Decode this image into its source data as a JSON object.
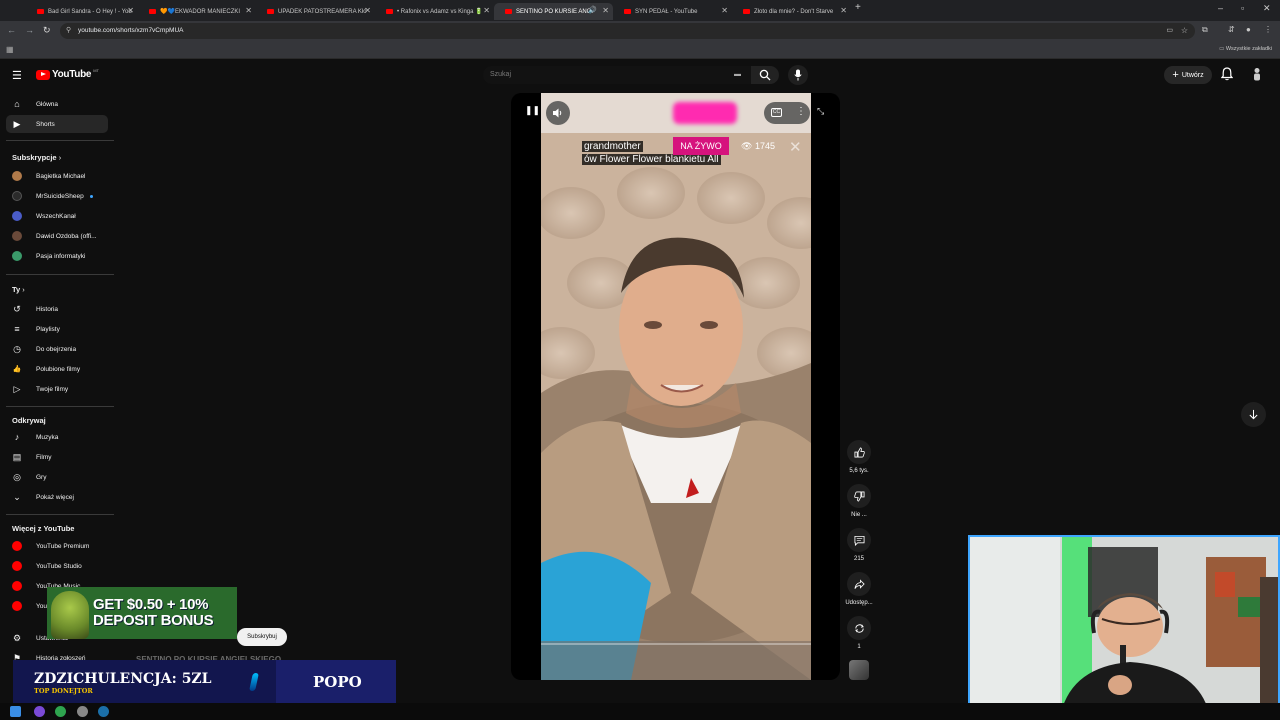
{
  "browser": {
    "tabs": [
      {
        "title": "Bad Girl Sandra - O Hey ! - You",
        "active": false
      },
      {
        "title": "🧡💙EKWADOR MANIECZKI",
        "active": false
      },
      {
        "title": "UPADEK PATOSTREAMERA Kłó",
        "active": false
      },
      {
        "title": "• Rafonix vs Adamz vs Kinga 🔋",
        "active": false
      },
      {
        "title": "SENTINO PO KURSIE ANGI",
        "active": true
      },
      {
        "title": "SYN PEDAŁ - YouTube",
        "active": false
      },
      {
        "title": "Złoto dla mnie? - Don't Starve",
        "active": false
      }
    ],
    "new_tab": "+",
    "url": "youtube.com/shorts/xzm7vCmpMUA",
    "bookmarks_all": "Wszystkie zakładki"
  },
  "header": {
    "logo_text": "YouTube",
    "logo_country": "MT",
    "search_placeholder": "Szukaj",
    "create_label": "Utwórz"
  },
  "sidebar": {
    "main": [
      {
        "label": "Główna",
        "icon": "home-icon",
        "glyph": "⌂"
      },
      {
        "label": "Shorts",
        "icon": "shorts-icon",
        "glyph": "▶"
      }
    ],
    "subs_heading": "Subskrypcje",
    "subs": [
      {
        "label": "Bagietka Michael",
        "color": "#b07a4a",
        "dot": false
      },
      {
        "label": "MrSuicideSheep",
        "color": "#2b2b2b",
        "dot": true
      },
      {
        "label": "WszechKanał",
        "color": "#4a5cc8",
        "dot": false
      },
      {
        "label": "Dawid Ozdoba (offi...",
        "color": "#6a4a3a",
        "dot": false
      },
      {
        "label": "Pasja informatyki",
        "color": "#3a9a6a",
        "dot": false
      }
    ],
    "you_heading": "Ty",
    "you": [
      {
        "label": "Historia",
        "icon": "history-icon",
        "glyph": "↺"
      },
      {
        "label": "Playlisty",
        "icon": "playlists-icon",
        "glyph": "≡"
      },
      {
        "label": "Do obejrzenia",
        "icon": "watch-later-icon",
        "glyph": "◷"
      },
      {
        "label": "Polubione filmy",
        "icon": "liked-icon",
        "glyph": "👍"
      },
      {
        "label": "Twoje filmy",
        "icon": "your-videos-icon",
        "glyph": "▷"
      }
    ],
    "explore_heading": "Odkrywaj",
    "explore": [
      {
        "label": "Muzyka",
        "icon": "music-icon",
        "glyph": "♪"
      },
      {
        "label": "Filmy",
        "icon": "movies-icon",
        "glyph": "▤"
      },
      {
        "label": "Gry",
        "icon": "gaming-icon",
        "glyph": "◎"
      },
      {
        "label": "Pokaż więcej",
        "icon": "chevron-down-icon",
        "glyph": "⌄"
      }
    ],
    "more_heading": "Więcej z YouTube",
    "more": [
      {
        "label": "YouTube Premium"
      },
      {
        "label": "YouTube Studio"
      },
      {
        "label": "YouTube Music"
      },
      {
        "label": "YouTube Kids"
      }
    ],
    "bottom": [
      {
        "label": "Ustawienia",
        "icon": "settings-icon",
        "glyph": "⚙"
      },
      {
        "label": "Historia zgłoszeń",
        "icon": "flag-icon",
        "glyph": "⚑"
      }
    ]
  },
  "player": {
    "overlay_line1": "grandmother",
    "overlay_line2": "ów Flower Flower blankietu All",
    "live_badge": "NA ŻYWO",
    "viewers": "1745"
  },
  "actions": {
    "likes": "5,6 tys.",
    "dislike": "Nie ...",
    "comments": "215",
    "share": "Udostęp...",
    "remix": "1"
  },
  "overlays": {
    "ad_line1": "GET $0.50 + 10%",
    "ad_line2": "DEPOSIT BONUS",
    "subscribe": "Subskrybuj",
    "faint_title": "SENTINO PO KURSIE ANGIELSKIEGO",
    "donation_main": "ZDZICHULENCJA: 5ZL",
    "donation_sub": "TOP DONEJTOR",
    "donation_right": "POPO"
  },
  "colors": {
    "accent_red": "#ff0000",
    "live_pink": "#d6137d",
    "webcam_border": "#3ea6ff",
    "donation_yellow": "#f5c400"
  }
}
